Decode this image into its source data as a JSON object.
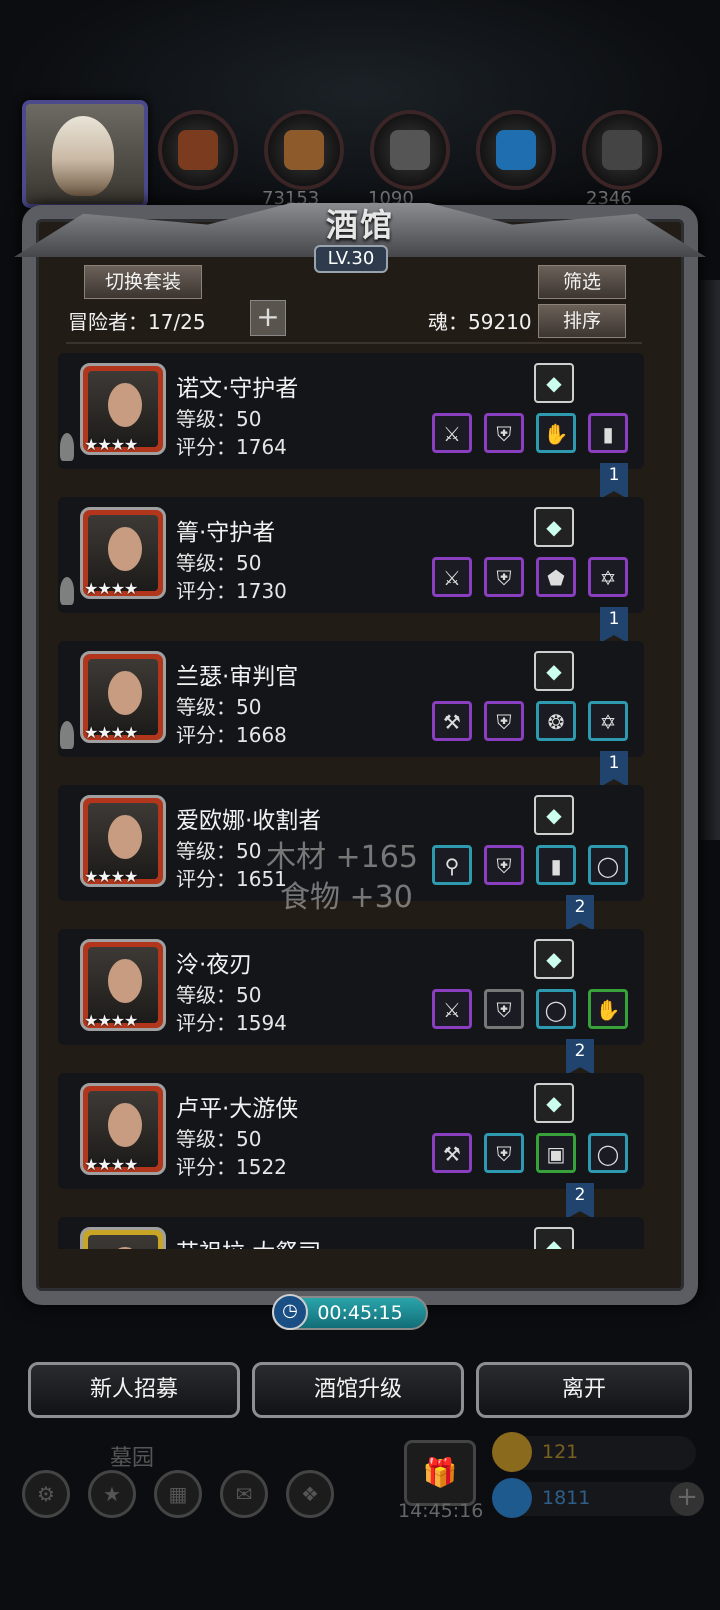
{
  "resources_bar": {
    "values": [
      "73153",
      "1090",
      "2346"
    ]
  },
  "panel": {
    "title": "酒馆",
    "level": "LV.30",
    "switch_outfit": "切换套装",
    "filter": "筛选",
    "sort": "排序",
    "adventurers_label": "冒险者：17/25",
    "add": "+",
    "soul_label": "魂：59210"
  },
  "heroes": [
    {
      "name": "诺文·守护者",
      "level": "等级：50",
      "score": "评分：1764",
      "stars": "★★★★",
      "weapon_icon": "moon-amulet-icon",
      "equipment": [
        {
          "icon": "sword-icon",
          "g": "⚔",
          "rarity": "purple"
        },
        {
          "icon": "armor-icon",
          "g": "⛨",
          "rarity": "purple"
        },
        {
          "icon": "gauntlet-icon",
          "g": "✋",
          "rarity": "blue"
        },
        {
          "icon": "wood-icon",
          "g": "▮",
          "rarity": "purple"
        }
      ],
      "team": "1"
    },
    {
      "name": "箐·守护者",
      "level": "等级：50",
      "score": "评分：1730",
      "stars": "★★★★",
      "weapon_icon": "red-gem-icon",
      "equipment": [
        {
          "icon": "sword-icon",
          "g": "⚔",
          "rarity": "purple"
        },
        {
          "icon": "armor-icon",
          "g": "⛨",
          "rarity": "purple"
        },
        {
          "icon": "shield-icon",
          "g": "⬟",
          "rarity": "purple"
        },
        {
          "icon": "necklace-icon",
          "g": "✡",
          "rarity": "purple"
        }
      ],
      "team": "1"
    },
    {
      "name": "兰瑟·审判官",
      "level": "等级：50",
      "score": "评分：1668",
      "stars": "★★★★",
      "weapon_icon": "bow-icon",
      "equipment": [
        {
          "icon": "hammer-icon",
          "g": "⚒",
          "rarity": "purple"
        },
        {
          "icon": "armor-icon",
          "g": "⛨",
          "rarity": "purple"
        },
        {
          "icon": "necklace-icon",
          "g": "❂",
          "rarity": "blue"
        },
        {
          "icon": "amulet-icon",
          "g": "✡",
          "rarity": "blue"
        }
      ],
      "team": "1"
    },
    {
      "name": "爱欧娜·收割者",
      "level": "等级：50",
      "score": "评分：1651",
      "stars": "★★★★",
      "weapon_icon": "glove-icon",
      "equipment": [
        {
          "icon": "axe-icon",
          "g": "⚲",
          "rarity": "blue"
        },
        {
          "icon": "armor-icon",
          "g": "⛨",
          "rarity": "purple"
        },
        {
          "icon": "wood-icon",
          "g": "▮",
          "rarity": "blue"
        },
        {
          "icon": "ring-icon",
          "g": "◯",
          "rarity": "blue"
        }
      ],
      "team": "2"
    },
    {
      "name": "泠·夜刃",
      "level": "等级：50",
      "score": "评分：1594",
      "stars": "★★★★",
      "weapon_icon": "blue-flame-icon",
      "equipment": [
        {
          "icon": "dagger-icon",
          "g": "⚔",
          "rarity": "purple"
        },
        {
          "icon": "armor-icon",
          "g": "⛨",
          "rarity": "grey"
        },
        {
          "icon": "ring-icon",
          "g": "◯",
          "rarity": "blue"
        },
        {
          "icon": "gauntlet-icon",
          "g": "✋",
          "rarity": "green"
        }
      ],
      "team": "2"
    },
    {
      "name": "卢平·大游侠",
      "level": "等级：50",
      "score": "评分：1522",
      "stars": "★★★★",
      "weapon_icon": "glove-icon",
      "equipment": [
        {
          "icon": "scythe-icon",
          "g": "⚒",
          "rarity": "purple"
        },
        {
          "icon": "vest-icon",
          "g": "⛨",
          "rarity": "blue"
        },
        {
          "icon": "chest-icon",
          "g": "▣",
          "rarity": "green"
        },
        {
          "icon": "ring-icon",
          "g": "◯",
          "rarity": "blue"
        }
      ],
      "team": "2"
    },
    {
      "name": "艾祖拉·大祭司",
      "level": "",
      "score": "",
      "stars": "",
      "weapon_icon": "red-gem-icon",
      "equipment": [],
      "team": ""
    }
  ],
  "floating_text": {
    "wood": "木材 +165",
    "food": "食物 +30"
  },
  "timer": "00:45:15",
  "buttons": {
    "recruit": "新人招募",
    "upgrade": "酒馆升级",
    "leave": "离开"
  },
  "hud": {
    "location": "墓园",
    "clock": "14:45:16",
    "gold": "121",
    "gems": "1811"
  },
  "colors": {
    "purple": "#8a3ec0",
    "blue": "#2e9ab0",
    "green": "#37a13a",
    "team_flag": "#21446e",
    "timer_bar": "#2aa4aa"
  }
}
